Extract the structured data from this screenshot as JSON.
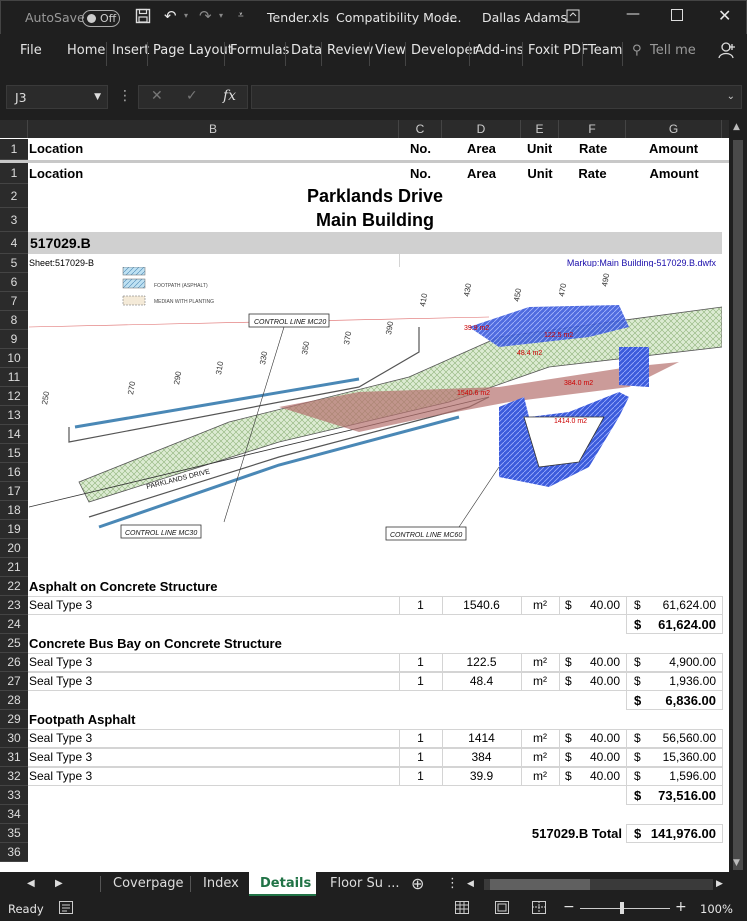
{
  "title_bar": {
    "autosave_label": "AutoSave",
    "autosave_state": "Off",
    "file_name": "Tender.xls",
    "mode": "Compatibility Mode",
    "title_separator": "-...",
    "user": "Dallas Adams"
  },
  "ribbon": {
    "tabs": [
      "File",
      "Home",
      "Insert",
      "Page Layout",
      "Formulas",
      "Data",
      "Review",
      "View",
      "Developer",
      "Add-ins",
      "Foxit PDF",
      "Team"
    ],
    "tell_me": "Tell me"
  },
  "formula_bar": {
    "name_box": "J3",
    "fx_label": "fx",
    "value": ""
  },
  "columns": [
    "B",
    "C",
    "D",
    "E",
    "F",
    "G"
  ],
  "frozen_header": {
    "row_num": "1",
    "location": "Location",
    "no": "No.",
    "area": "Area",
    "unit": "Unit",
    "rate": "Rate",
    "amount": "Amount"
  },
  "sheet": {
    "header": {
      "location": "Location",
      "no": "No.",
      "area": "Area",
      "unit": "Unit",
      "rate": "Rate",
      "amount": "Amount"
    },
    "title1": "Parklands Drive",
    "title2": "Main Building",
    "code": "517029.B",
    "sheet_ref": "Sheet:517029-B",
    "markup_link": "Markup:Main Building-517029.B.dwfx",
    "drawing": {
      "labels": [
        "CONTROL LINE MC20",
        "CONTROL LINE MC30",
        "CONTROL LINE MC60",
        "PARKLANDS DRIVE",
        "FOOTPATH (ASPHALT)",
        "MEDIAN WITH PLANTING"
      ],
      "chainages": [
        "250",
        "270",
        "290",
        "310",
        "330",
        "350",
        "370",
        "390",
        "410",
        "430",
        "450",
        "470",
        "490"
      ],
      "area_labels": [
        "1540.6 m2",
        "1414.0 m2",
        "122.5 m2",
        "48.4 m2",
        "384.0 m2",
        "39.9 m2"
      ]
    },
    "sections": [
      {
        "name": "Asphalt on Concrete Structure",
        "rows": [
          {
            "desc": "Seal Type 3",
            "no": "1",
            "area": "1540.6",
            "unit": "m²",
            "rate": "40.00",
            "amount": "61,624.00"
          }
        ],
        "subtotal": "61,624.00"
      },
      {
        "name": "Concrete Bus Bay on Concrete Structure",
        "rows": [
          {
            "desc": "Seal Type 3",
            "no": "1",
            "area": "122.5",
            "unit": "m²",
            "rate": "40.00",
            "amount": "4,900.00"
          },
          {
            "desc": "Seal Type 3",
            "no": "1",
            "area": "48.4",
            "unit": "m²",
            "rate": "40.00",
            "amount": "1,936.00"
          }
        ],
        "subtotal": "6,836.00"
      },
      {
        "name": "Footpath Asphalt",
        "rows": [
          {
            "desc": "Seal Type 3",
            "no": "1",
            "area": "1414",
            "unit": "m²",
            "rate": "40.00",
            "amount": "56,560.00"
          },
          {
            "desc": "Seal Type 3",
            "no": "1",
            "area": "384",
            "unit": "m²",
            "rate": "40.00",
            "amount": "15,360.00"
          },
          {
            "desc": "Seal Type 3",
            "no": "1",
            "area": "39.9",
            "unit": "m²",
            "rate": "40.00",
            "amount": "1,596.00"
          }
        ],
        "subtotal": "73,516.00"
      }
    ],
    "currency": "$",
    "total_label": "517029.B Total",
    "total": "141,976.00"
  },
  "sheet_tabs": {
    "tabs": [
      "Coverpage",
      "Index",
      "Details",
      "Floor Su ..."
    ],
    "active": "Details"
  },
  "status": {
    "ready": "Ready",
    "zoom": "100%"
  },
  "colors": {
    "accent": "#217346",
    "hatch_blue": "#3b5bdb",
    "hatch_red": "#b5706d",
    "hatch_green": "#b8d8a8"
  }
}
